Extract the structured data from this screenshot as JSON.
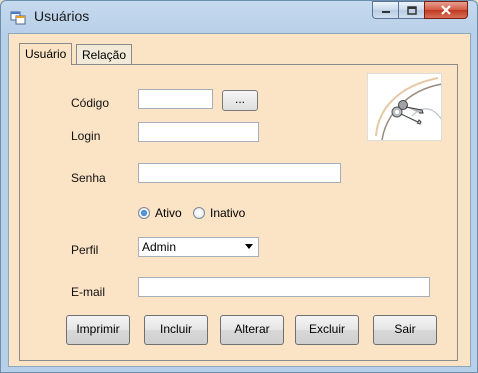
{
  "window": {
    "title": "Usuários",
    "controls": {
      "minimize_icon": "minimize-icon",
      "maximize_icon": "maximize-icon",
      "close_icon": "close-icon"
    }
  },
  "tabs": [
    {
      "label": "Usuário",
      "active": true
    },
    {
      "label": "Relação",
      "active": false
    }
  ],
  "form": {
    "codigo": {
      "label": "Código",
      "value": "",
      "browse_label": "..."
    },
    "login": {
      "label": "Login",
      "value": ""
    },
    "senha": {
      "label": "Senha",
      "value": ""
    },
    "status": {
      "options": [
        {
          "label": "Ativo",
          "checked": true
        },
        {
          "label": "Inativo",
          "checked": false
        }
      ]
    },
    "perfil": {
      "label": "Perfil",
      "selected": "Admin"
    },
    "email": {
      "label": "E-mail",
      "value": ""
    },
    "image_icon": "keys-icon"
  },
  "buttons": {
    "imprimir": "Imprimir",
    "incluir": "Incluir",
    "alterar": "Alterar",
    "excluir": "Excluir",
    "sair": "Sair"
  },
  "colors": {
    "form_background": "#fbe3c6",
    "window_frame": "#b7cfe8",
    "close_button": "#c0381f"
  }
}
